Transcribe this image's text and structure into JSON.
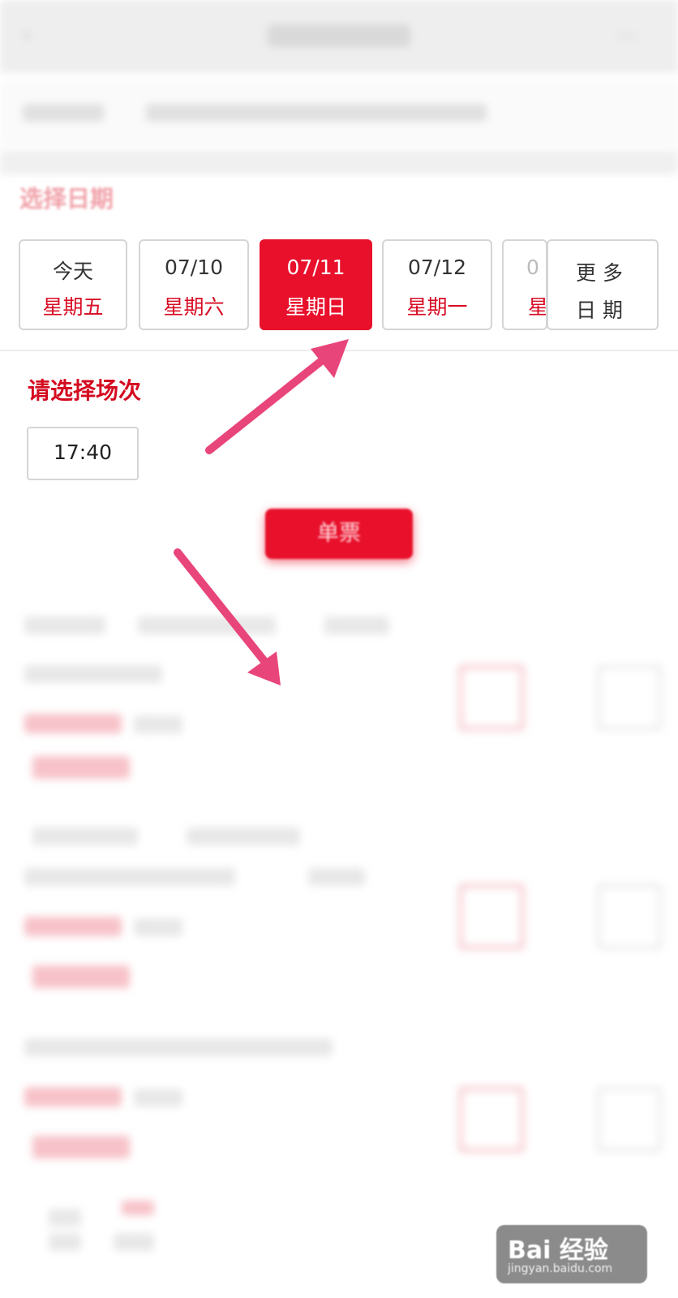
{
  "header": {
    "back_icon": "back-arrow-icon",
    "more_icon": "more-icon"
  },
  "date_section": {
    "title": "选择日期",
    "dates": [
      {
        "date": "今天",
        "weekday": "星期五",
        "selected": false
      },
      {
        "date": "07/10",
        "weekday": "星期六",
        "selected": false
      },
      {
        "date": "07/11",
        "weekday": "星期日",
        "selected": true
      },
      {
        "date": "07/12",
        "weekday": "星期一",
        "selected": false
      },
      {
        "date": "0",
        "weekday": "星",
        "selected": false
      }
    ],
    "more": {
      "line1": "更多",
      "line2": "日期"
    }
  },
  "session_section": {
    "title": "请选择场次",
    "times": [
      "17:40"
    ]
  },
  "ticket_button": {
    "label": "单票"
  },
  "watermark": {
    "brand": "Bai 经验",
    "url": "jingyan.baidu.com"
  },
  "colors": {
    "accent": "#e8102b",
    "accent_text": "#d40b20",
    "annotation_arrow": "#e8457a"
  }
}
